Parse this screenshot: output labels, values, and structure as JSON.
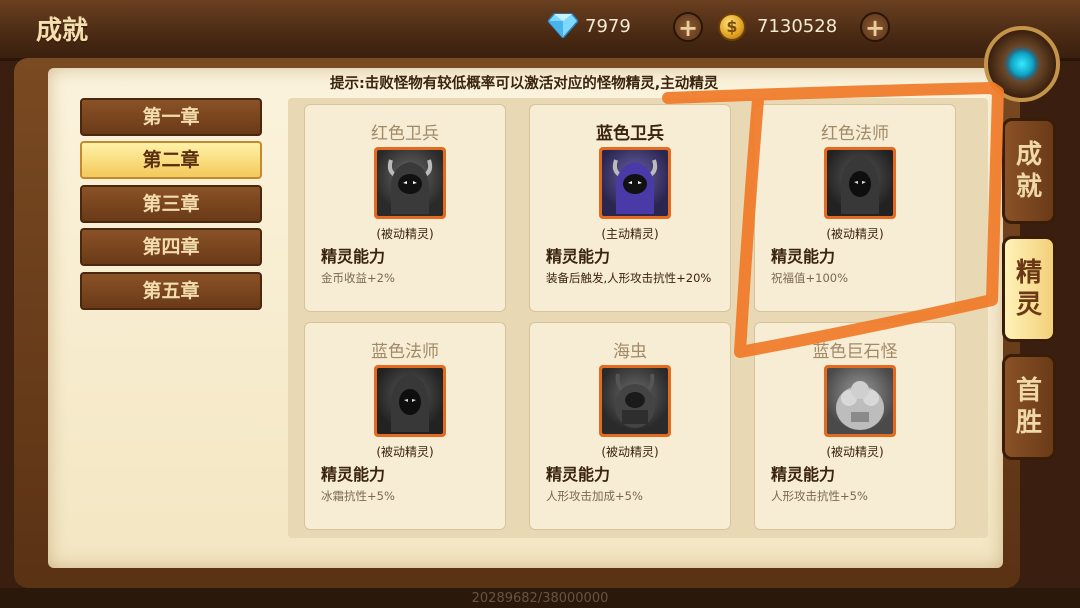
{
  "header": {
    "title": "成就",
    "gems": "7979",
    "gold": "7130528",
    "gems_icon": "diamond-icon",
    "gold_icon": "gold-coin-icon",
    "plus_label": "+"
  },
  "hint": "提示:击败怪物有较低概率可以激活对应的怪物精灵,主动精灵",
  "chapters": [
    {
      "label": "第一章",
      "active": false
    },
    {
      "label": "第二章",
      "active": true
    },
    {
      "label": "第三章",
      "active": false
    },
    {
      "label": "第四章",
      "active": false
    },
    {
      "label": "第五章",
      "active": false
    }
  ],
  "cards": [
    {
      "name": "红色卫兵",
      "type": "(被动精灵)",
      "ability": "精灵能力",
      "effect": "金币收益+2%",
      "highlight": false
    },
    {
      "name": "蓝色卫兵",
      "type": "(主动精灵)",
      "ability": "精灵能力",
      "effect": "装备后触发,人形攻击抗性+20%",
      "highlight": true
    },
    {
      "name": "红色法师",
      "type": "(被动精灵)",
      "ability": "精灵能力",
      "effect": "祝福值+100%",
      "highlight": false
    },
    {
      "name": "蓝色法师",
      "type": "(被动精灵)",
      "ability": "精灵能力",
      "effect": "冰霜抗性+5%",
      "highlight": false
    },
    {
      "name": "海虫",
      "type": "(被动精灵)",
      "ability": "精灵能力",
      "effect": "人形攻击加成+5%",
      "highlight": false
    },
    {
      "name": "蓝色巨石怪",
      "type": "(被动精灵)",
      "ability": "精灵能力",
      "effect": "人形攻击抗性+5%",
      "highlight": false
    }
  ],
  "side_tabs": [
    {
      "label": "成就",
      "active": false
    },
    {
      "label": "精灵",
      "active": true
    },
    {
      "label": "首胜",
      "active": false
    }
  ],
  "footer": "20289682/38000000",
  "colors": {
    "annotation": "#f07a28",
    "portrait_border": "#e36a1e",
    "active_chapter": "#f3c95a"
  }
}
